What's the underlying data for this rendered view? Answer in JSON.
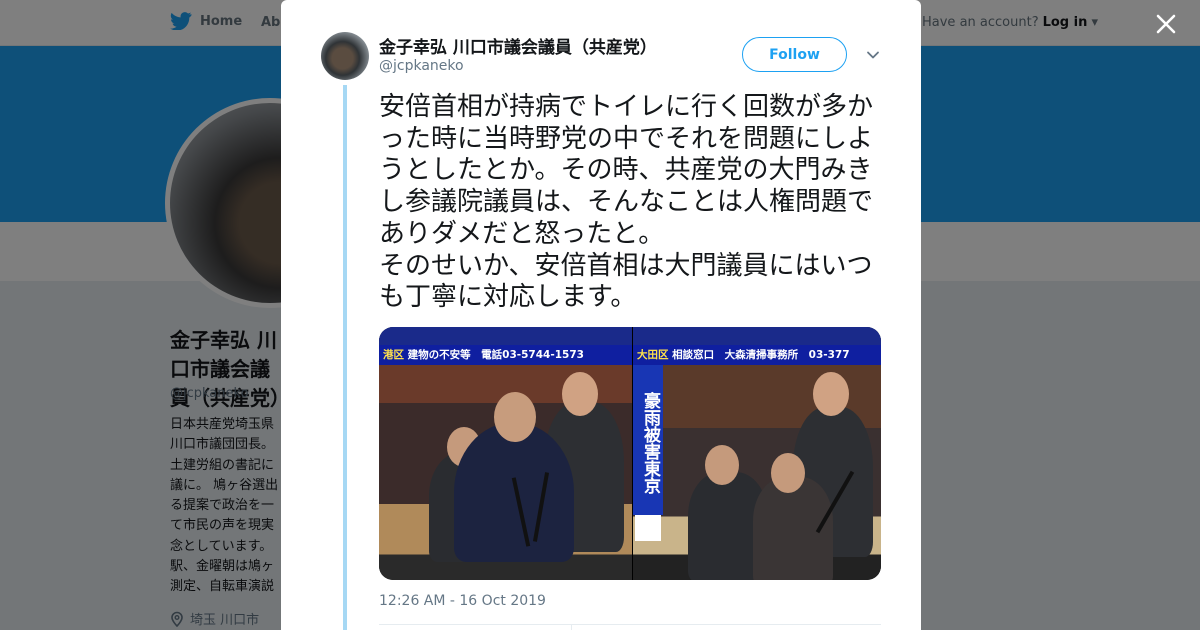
{
  "topbar": {
    "home_label": "Home",
    "about_label": "About",
    "account_prompt": "Have an account?",
    "login_label": "Log in"
  },
  "profile": {
    "name": "金子幸弘 川口市議会議員（共産党）",
    "handle": "@jcpkaneko",
    "bio": "日本共産党埼玉県\n川口市議団団長。\n土建労組の書記に\n議に。 鳩ヶ谷選出\nる提案で政治を一\nて市民の声を現実\n念としています。\n駅、金曜朝は鳩ヶ\n測定、自転車演説",
    "location": "埼玉 川口市"
  },
  "tweet": {
    "author_name": "金子幸弘 川口市議会議員（共産党）",
    "author_handle": "@jcpkaneko",
    "follow_label": "Follow",
    "text": "安倍首相が持病でトイレに行く回数が多かった時に当時野党の中でそれを問題にしようとしたとか。その時、共産党の大門みきし参議院議員は、そんなことは人権問題でありダメだと怒ったと。\nそのせいか、安倍首相は大門議員にはいつも丁寧に対応します。",
    "timestamp": "12:26 AM - 16 Oct 2019"
  },
  "media": {
    "left_ticker_prefix": "港区",
    "left_ticker": "建物の不安等　電話03-5744-1573",
    "right_ticker_prefix": "大田区",
    "right_ticker": "相談窓口　大森清掃事務所　03-377",
    "vertical_caption": "豪雨被害東京"
  },
  "icons": {
    "twitter_bird": "twitter-bird-icon",
    "close": "close-icon",
    "caret": "chevron-down-icon",
    "location": "location-pin-icon"
  },
  "colors": {
    "brand_blue": "#1da1f2",
    "thread_line": "#a6d8f4",
    "text_secondary": "#657786"
  }
}
